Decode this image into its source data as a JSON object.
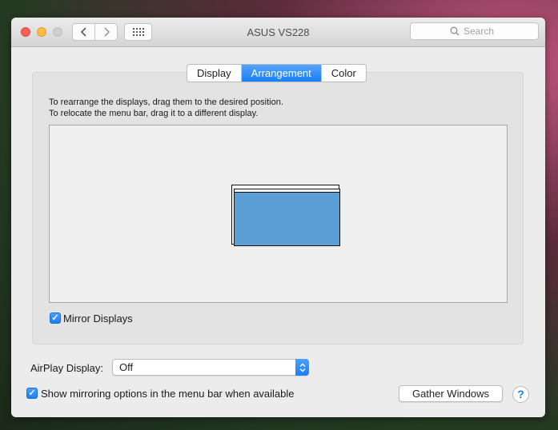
{
  "window": {
    "title": "ASUS VS228"
  },
  "toolbar": {
    "back_icon": "chevron-left-icon",
    "forward_icon": "chevron-right-icon",
    "grid_icon": "grid-icon",
    "search_placeholder": "Search",
    "search_icon": "magnifier-icon"
  },
  "tabs": [
    {
      "label": "Display",
      "active": false
    },
    {
      "label": "Arrangement",
      "active": true
    },
    {
      "label": "Color",
      "active": false
    }
  ],
  "arrangement": {
    "instruction_1": "To rearrange the displays, drag them to the desired position.",
    "instruction_2": "To relocate the menu bar, drag it to a different display.",
    "mirror_label": "Mirror Displays",
    "mirror_checked": true
  },
  "airplay": {
    "label": "AirPlay Display:",
    "value": "Off"
  },
  "show_mirroring": {
    "label": "Show mirroring options in the menu bar when available",
    "checked": true
  },
  "buttons": {
    "gather_windows": "Gather Windows",
    "help": "?"
  },
  "colors": {
    "accent": "#1a7ff6",
    "display_fill": "#5b9fd6",
    "close": "#fc605c",
    "minimize": "#fdbc40"
  }
}
